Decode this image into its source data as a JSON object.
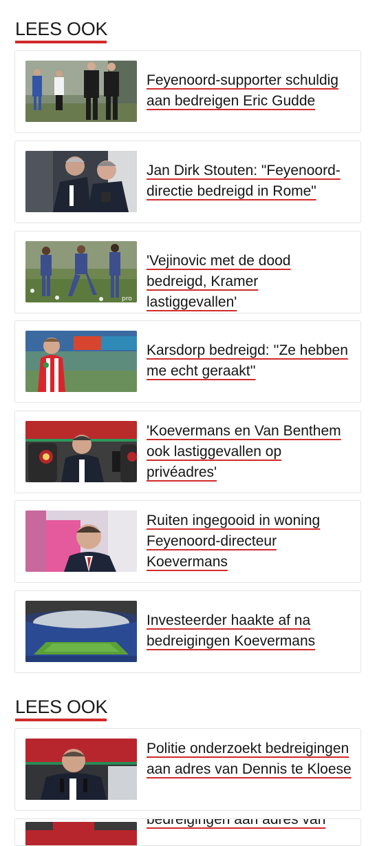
{
  "sections": [
    {
      "heading": "LEES OOK",
      "articles": [
        {
          "title": "Feyenoord-supporter schuldig aan bedreigen Eric Gudde",
          "image": "training-ground-photo"
        },
        {
          "title": "Jan Dirk Stouten: \"Feyenoord-directie bedreigd in Rome\"",
          "image": "directors-meeting-photo"
        },
        {
          "title": "'Vejinovic met de dood bedreigd, Kramer lastiggevallen'",
          "image": "players-training-photo"
        },
        {
          "title": "Karsdorp bedreigd: ''Ze hebben me echt geraakt''",
          "image": "karsdorp-photo"
        },
        {
          "title": "'Koevermans en Van Benthem ook lastiggevallen op privéadres'",
          "image": "press-conference-photo"
        },
        {
          "title": "Ruiten ingegooid in woning Feyenoord-directeur Koevermans",
          "image": "director-portrait-photo"
        },
        {
          "title": "Investeerder haakte af na bedreigingen Koevermans",
          "image": "stadium-photo"
        }
      ]
    },
    {
      "heading": "LEES OOK",
      "articles": [
        {
          "title": "Politie onderzoekt bedreigingen aan adres van Dennis te Kloese",
          "image": "te-kloese-press-photo"
        },
        {
          "title": "bedreigingen aan adres van",
          "image": "partial-photo"
        }
      ]
    }
  ],
  "colors": {
    "accent": "#d12a2a",
    "text": "#151515",
    "border": "#e4e4e4"
  }
}
